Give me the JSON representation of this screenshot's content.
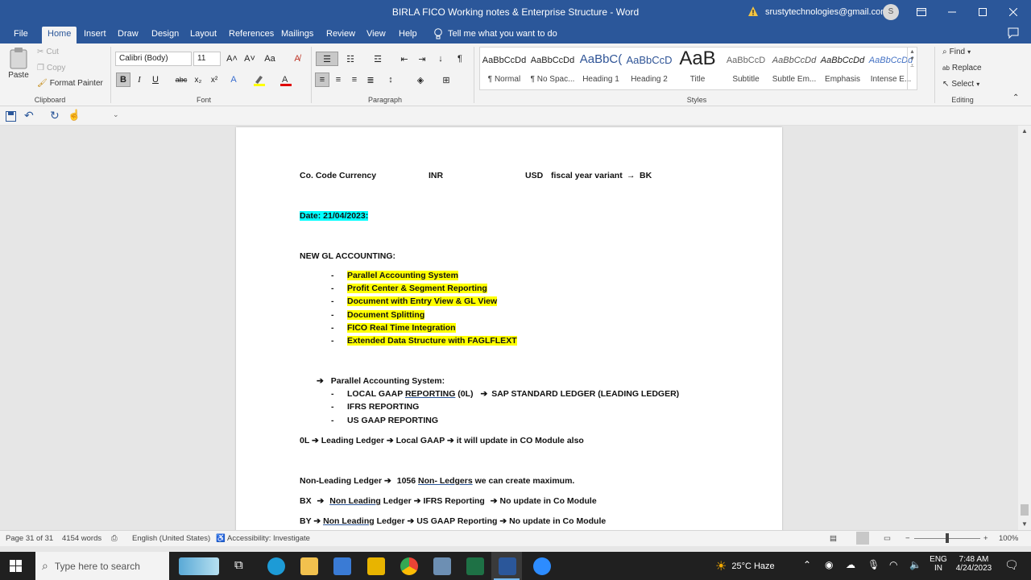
{
  "window": {
    "title": "BIRLA FICO Working notes & Enterprise Structure  -  Word",
    "account_email": "srustytechnologies@gmail.com",
    "avatar_letter": "S"
  },
  "tabs": [
    "File",
    "Home",
    "Insert",
    "Draw",
    "Design",
    "Layout",
    "References",
    "Mailings",
    "Review",
    "View",
    "Help"
  ],
  "tell_me": "Tell me what you want to do",
  "ribbon": {
    "clipboard": {
      "paste": "Paste",
      "cut": "Cut",
      "copy": "Copy",
      "format_painter": "Format Painter",
      "label": "Clipboard"
    },
    "font": {
      "name": "Calibri (Body)",
      "size": "11",
      "label": "Font"
    },
    "paragraph": {
      "label": "Paragraph"
    },
    "styles": {
      "label": "Styles",
      "items": [
        {
          "preview": "AaBbCcDd",
          "name": "¶ Normal"
        },
        {
          "preview": "AaBbCcDd",
          "name": "¶ No Spac..."
        },
        {
          "preview": "AaBbC(",
          "name": "Heading 1"
        },
        {
          "preview": "AaBbCcD",
          "name": "Heading 2"
        },
        {
          "preview": "AaB",
          "name": "Title"
        },
        {
          "preview": "AaBbCcD",
          "name": "Subtitle"
        },
        {
          "preview": "AaBbCcDd",
          "name": "Subtle Em..."
        },
        {
          "preview": "AaBbCcDd",
          "name": "Emphasis"
        },
        {
          "preview": "AaBbCcDd",
          "name": "Intense E..."
        }
      ]
    },
    "editing": {
      "find": "Find",
      "replace": "Replace",
      "select": "Select",
      "label": "Editing"
    }
  },
  "document": {
    "line1": {
      "a": "Co. Code Currency",
      "b": "INR",
      "c": "USD",
      "d": "fiscal year variant",
      "e": "BK"
    },
    "date": "Date: 21/04/2023:",
    "heading": "NEW GL ACCOUNTING:",
    "bullets": [
      "Parallel Accounting System",
      "Profit Center & Segment Reporting",
      "Document with Entry View & GL View",
      "Document Splitting",
      "FICO Real Time Integration",
      "Extended Data Structure with FAGLFLEXT"
    ],
    "pas_heading": "Parallel Accounting System:",
    "pas_items": {
      "first_a": "LOCAL GAAP ",
      "first_b": "REPORTING",
      "first_c": "  (0L)",
      "first_d": "SAP STANDARD LEDGER  (LEADING LEDGER)",
      "second": "IFRS REPORTING",
      "third": "US GAAP REPORTING"
    },
    "ol_line": {
      "a": "0L",
      "b": "Leading Ledger",
      "c": "Local GAAP",
      "d": "it will update in CO Module also"
    },
    "nl_line": {
      "a": "Non-Leading Ledger",
      "b": "1056 ",
      "c": "Non- Ledgers",
      "d": " we can create maximum."
    },
    "bx_line": {
      "a": "BX",
      "b": "Non Leading",
      "c": " Ledger",
      "d": "IFRS Reporting",
      "e": "No update in Co Module"
    },
    "by_line": {
      "a": "BY",
      "b": "Non Leading",
      "c": " Ledger",
      "d": "US GAAP Reporting",
      "e": "No update in Co Module"
    }
  },
  "status": {
    "page": "Page 31 of 31",
    "words": "4154 words",
    "language": "English (United States)",
    "accessibility": "Accessibility: Investigate",
    "zoom": "100%"
  },
  "taskbar": {
    "search_placeholder": "Type here to search",
    "weather": "25°C  Haze",
    "lang_top": "ENG",
    "lang_bottom": "IN",
    "time": "7:48 AM",
    "date": "4/24/2023"
  },
  "colors": {
    "word_blue": "#2b579a",
    "highlight_yellow": "#ffff00",
    "highlight_cyan": "#00ffff"
  }
}
